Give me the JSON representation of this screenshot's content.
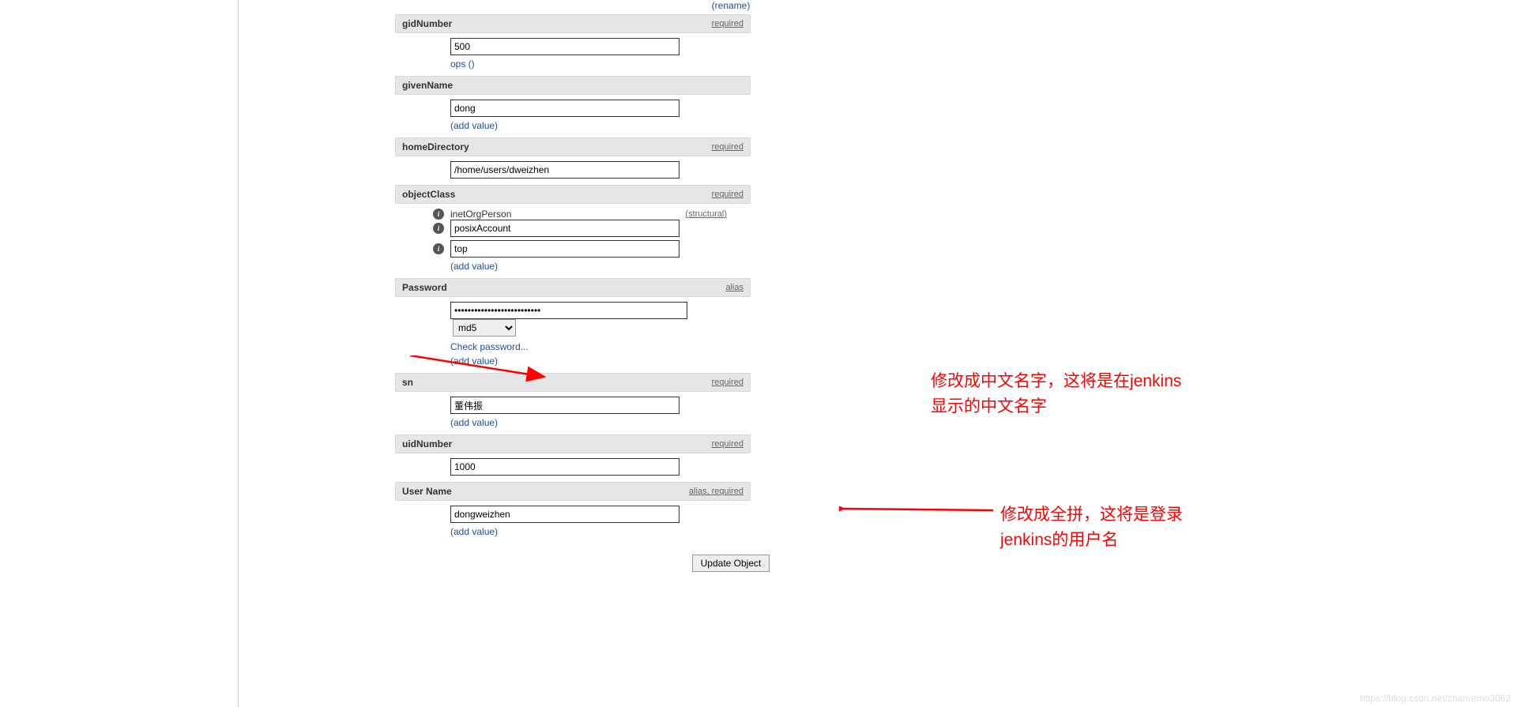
{
  "topLink": "(rename)",
  "sections": {
    "gidNumber": {
      "label": "gidNumber",
      "meta": "required",
      "value": "500",
      "extra": "ops ()"
    },
    "givenName": {
      "label": "givenName",
      "value": "dong",
      "addValue": "add value"
    },
    "homeDirectory": {
      "label": "homeDirectory",
      "meta": "required",
      "value": "/home/users/dweizhen"
    },
    "objectClass": {
      "label": "objectClass",
      "meta": "required",
      "structuralLabel": "structural",
      "staticValue": "inetOrgPerson",
      "val2": "posixAccount",
      "val3": "top",
      "addValue": "add value"
    },
    "password": {
      "label": "Password",
      "meta": "alias",
      "value": "••••••••••••••••••••••••••",
      "hashOption": "md5",
      "checkPassword": "Check password...",
      "addValue": "add value"
    },
    "sn": {
      "label": "sn",
      "meta": "required",
      "value": "董伟振",
      "addValue": "add value"
    },
    "uidNumber": {
      "label": "uidNumber",
      "meta": "required",
      "value": "1000"
    },
    "userName": {
      "label": "User Name",
      "meta1": "alias",
      "meta2": "required",
      "value": "dongweizhen",
      "addValue": "add value"
    }
  },
  "submitLabel": "Update Object",
  "annotations": {
    "anno1": "修改成中文名字，这将是在jenkins显示的中文名字",
    "anno2": "修改成全拼，这将是登录jenkins的用户名"
  },
  "watermark": "https://blog.csdn.net/zhanremo3062"
}
